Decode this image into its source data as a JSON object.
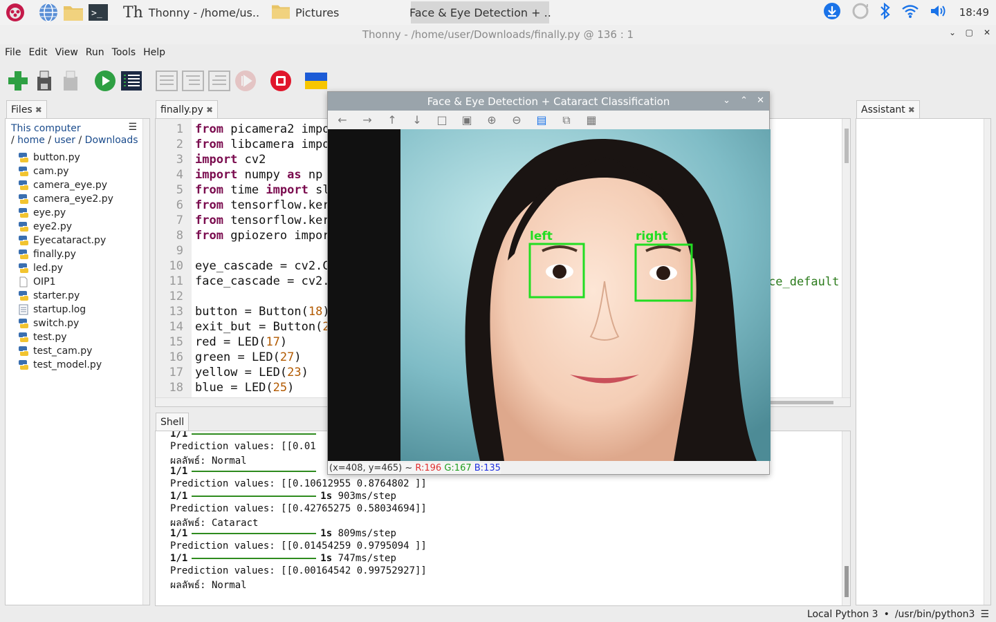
{
  "taskbar": {
    "tasks": [
      {
        "label": "Thonny  -  /home/us.."
      },
      {
        "label": "Pictures"
      },
      {
        "label": "Face & Eye Detection + .."
      }
    ],
    "clock": "18:49"
  },
  "window": {
    "title": "Thonny  -  /home/user/Downloads/finally.py  @  136 : 1"
  },
  "menu": [
    "File",
    "Edit",
    "View",
    "Run",
    "Tools",
    "Help"
  ],
  "files": {
    "tab_label": "Files",
    "location_root": "This computer",
    "path": [
      "home",
      "user",
      "Downloads"
    ],
    "items": [
      {
        "name": "button.py",
        "icon": "python-file-icon"
      },
      {
        "name": "cam.py",
        "icon": "python-file-icon"
      },
      {
        "name": "camera_eye.py",
        "icon": "python-file-icon"
      },
      {
        "name": "camera_eye2.py",
        "icon": "python-file-icon"
      },
      {
        "name": "eye.py",
        "icon": "python-file-icon"
      },
      {
        "name": "eye2.py",
        "icon": "python-file-icon"
      },
      {
        "name": "Eyecataract.py",
        "icon": "python-file-icon"
      },
      {
        "name": "finally.py",
        "icon": "python-file-icon"
      },
      {
        "name": "led.py",
        "icon": "python-file-icon"
      },
      {
        "name": "OIP1",
        "icon": "blank-file-icon"
      },
      {
        "name": "starter.py",
        "icon": "python-file-icon"
      },
      {
        "name": "startup.log",
        "icon": "text-file-icon"
      },
      {
        "name": "switch.py",
        "icon": "python-file-icon"
      },
      {
        "name": "test.py",
        "icon": "python-file-icon"
      },
      {
        "name": "test_cam.py",
        "icon": "python-file-icon"
      },
      {
        "name": "test_model.py",
        "icon": "python-file-icon"
      }
    ]
  },
  "editor": {
    "tab_label": "finally.py",
    "line_numbers": [
      "1",
      "2",
      "3",
      "4",
      "5",
      "6",
      "7",
      "8",
      "9",
      "10",
      "11",
      "12",
      "13",
      "14",
      "15",
      "16",
      "17",
      "18"
    ],
    "lines": [
      "from picamera2 impo",
      "from libcamera impo",
      "import cv2",
      "import numpy as np",
      "from time import sl",
      "from tensorflow.ker",
      "from tensorflow.ker",
      "from gpiozero impor",
      "",
      "eye_cascade = cv2.C",
      "face_cascade = cv2.",
      "",
      "button = Button(18)",
      "exit_but = Button(2",
      "red = LED(17)",
      "green = LED(27)",
      "yellow = LED(23)",
      "blue = LED(25)"
    ],
    "overflow_text": "ce_default"
  },
  "shell": {
    "tab_label": "Shell",
    "lines": [
      {
        "kind": "progress",
        "step": "1/1",
        "time": "",
        "rate": ""
      },
      {
        "kind": "text",
        "text": "Prediction values: [[0.01"
      },
      {
        "kind": "text",
        "text": "ผลลัพธ์: Normal"
      },
      {
        "kind": "progress",
        "step": "1/1",
        "time": "",
        "rate": ""
      },
      {
        "kind": "text",
        "text": "Prediction values: [[0.10612955 0.8764802 ]]"
      },
      {
        "kind": "progress",
        "step": "1/1",
        "time": "1s",
        "rate": "903ms/step"
      },
      {
        "kind": "text",
        "text": "Prediction values: [[0.42765275 0.58034694]]"
      },
      {
        "kind": "text",
        "text": "ผลลัพธ์: Cataract"
      },
      {
        "kind": "progress",
        "step": "1/1",
        "time": "1s",
        "rate": "809ms/step"
      },
      {
        "kind": "text",
        "text": "Prediction values: [[0.01454259 0.9795094 ]]"
      },
      {
        "kind": "progress",
        "step": "1/1",
        "time": "1s",
        "rate": "747ms/step"
      },
      {
        "kind": "text",
        "text": "Prediction values: [[0.00164542 0.99752927]]"
      },
      {
        "kind": "text",
        "text": "ผลลัพธ์: Normal"
      }
    ]
  },
  "assistant": {
    "tab_label": "Assistant"
  },
  "statusbar": {
    "interpreter": "Local Python 3",
    "separator": "•",
    "path": "/usr/bin/python3"
  },
  "cv_window": {
    "title": "Face & Eye Detection + Cataract Classification",
    "labels": {
      "left": "left",
      "right": "right"
    },
    "status": {
      "coords": "(x=408, y=465) ~",
      "r": "R:196",
      "g": "G:167",
      "b": "B:135"
    }
  },
  "colors": {
    "keyword": "#7a0b4e",
    "number": "#b25a00",
    "detection_box": "#22dd22",
    "progress_bar": "#2e8b1e",
    "accent_blue": "#1a73e8"
  }
}
